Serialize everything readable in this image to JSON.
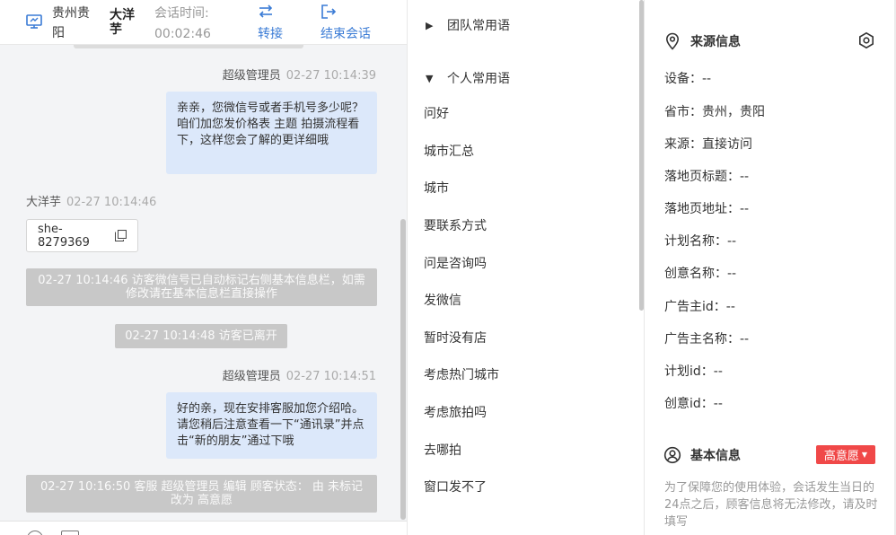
{
  "header": {
    "location": "贵州贵阳",
    "visitor_name": "大洋芋",
    "session_time_label": "会话时间:",
    "session_time_value": "00:02:46",
    "transfer_label": "转接",
    "end_label": "结束会话"
  },
  "messages": [
    {
      "sender": "超级管理员",
      "time": "02-27 10:14:39",
      "text": "亲亲，您微信号或者手机号多少呢？咱们加您发价格表 主题 拍摄流程看下，这样您会了解的更详细哦"
    },
    {
      "sender": "大洋芋",
      "time": "02-27 10:14:46",
      "code": "she-8279369"
    },
    {
      "system": "02-27 10:14:46 访客微信号已自动标记右侧基本信息栏，如需修改请在基本信息栏直接操作"
    },
    {
      "system": "02-27 10:14:48 访客已离开"
    },
    {
      "sender": "超级管理员",
      "time": "02-27 10:14:51",
      "text": "好的亲，现在安排客服加您介绍哈。请您稍后注意查看一下“通讯录”并点击“新的朋友”通过下哦"
    },
    {
      "system": "02-27 10:16:50 客服 超级管理员 编辑 顾客状态： 由 未标记 改为 高意愿"
    }
  ],
  "phrases": {
    "team_group": "团队常用语",
    "personal_group": "个人常用语",
    "items": [
      "问好",
      "城市汇总",
      "城市",
      "要联系方式",
      "问是咨询吗",
      "发微信",
      "暂时没有店",
      "考虑热门城市",
      "考虑旅拍吗",
      "去哪拍",
      "窗口发不了"
    ]
  },
  "source_info": {
    "title": "来源信息",
    "rows": [
      "设备：--",
      "省市：贵州，贵阳",
      "来源：直接访问",
      "落地页标题：--",
      "落地页地址：--",
      "计划名称：--",
      "创意名称：--",
      "广告主id：--",
      "广告主名称：--",
      "计划id：--",
      "创意id：--"
    ]
  },
  "basic_info": {
    "title": "基本信息",
    "intent_label": "高意愿",
    "notice": "为了保障您的使用体验，会话发生当日的24点之后，顾客信息将无法修改，请及时填写"
  },
  "colors": {
    "accent_blue": "#3a7bd5",
    "bubble_blue": "#dce8fa",
    "system_grey": "#c8c8c8",
    "intent_red": "#f04848"
  }
}
